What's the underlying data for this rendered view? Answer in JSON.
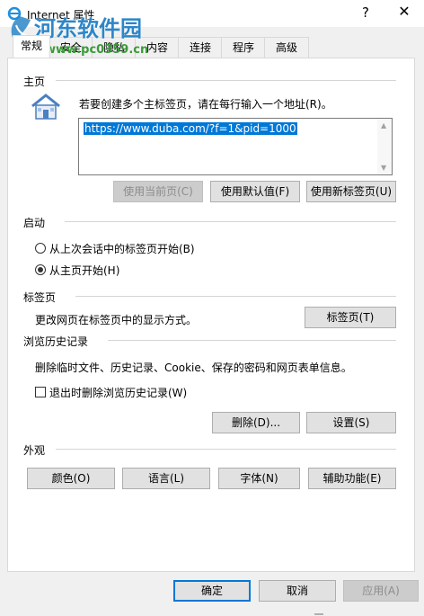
{
  "window": {
    "title": "Internet 属性",
    "help": "?",
    "close": "✕"
  },
  "watermark": {
    "site": "河东软件园",
    "url": "www.pc0359.cn"
  },
  "tabs": [
    "常规",
    "安全",
    "隐私",
    "内容",
    "连接",
    "程序",
    "高级"
  ],
  "home": {
    "heading": "主页",
    "hint": "若要创建多个主标签页，请在每行输入一个地址(R)。",
    "url": "https://www.duba.com/?f=1&pid=1000",
    "use_current": "使用当前页(C)",
    "use_default": "使用默认值(F)",
    "use_new_tab": "使用新标签页(U)"
  },
  "startup": {
    "heading": "启动",
    "option_last_session": "从上次会话中的标签页开始(B)",
    "option_home": "从主页开始(H)"
  },
  "tabs_section": {
    "heading": "标签页",
    "desc": "更改网页在标签页中的显示方式。",
    "button": "标签页(T)"
  },
  "history": {
    "heading": "浏览历史记录",
    "desc": "删除临时文件、历史记录、Cookie、保存的密码和网页表单信息。",
    "checkbox": "退出时删除浏览历史记录(W)",
    "delete": "删除(D)...",
    "settings": "设置(S)"
  },
  "appearance": {
    "heading": "外观",
    "colors": "颜色(O)",
    "languages": "语言(L)",
    "fonts": "字体(N)",
    "accessibility": "辅助功能(E)"
  },
  "footer": {
    "ok": "确定",
    "cancel": "取消",
    "apply": "应用(A)"
  },
  "colors": {
    "accent": "#0078d7",
    "watermark_blue": "#2c86c9",
    "watermark_green": "#3a9a3a"
  }
}
